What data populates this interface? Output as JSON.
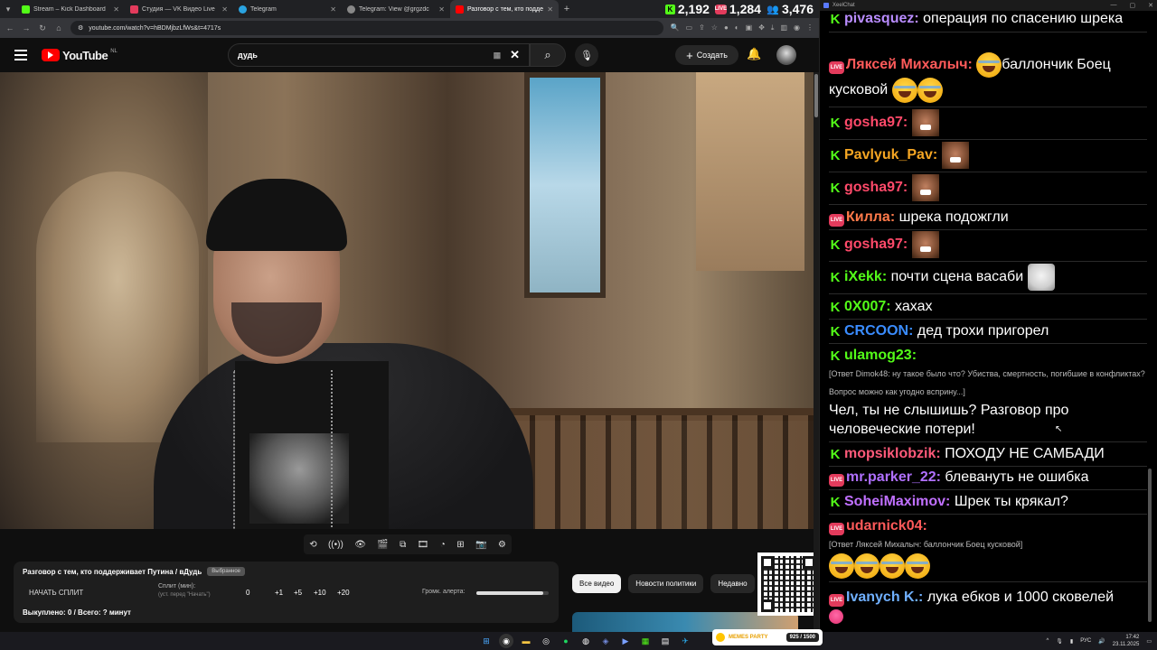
{
  "browser": {
    "tabs": [
      {
        "label": "Stream – Kick Dashboard",
        "color": "#53fc18"
      },
      {
        "label": "Студия — VK Видео Live",
        "color": "#e33b5c"
      },
      {
        "label": "Telegram",
        "color": "#2aa3e0"
      },
      {
        "label": "Telegram: View @grgzdc",
        "color": "#888888"
      },
      {
        "label": "Разговор с тем, кто поддерж...",
        "color": "#ff0000"
      }
    ],
    "url": "youtube.com/watch?v=hBDMjbzLfWs&t=4717s"
  },
  "stats": {
    "kick_viewers": "2,192",
    "vk_viewers": "1,284",
    "total_viewers": "3,476",
    "vk_badge": "LIVE",
    "kick_badge": "K"
  },
  "youtube": {
    "logo_text": "YouTube",
    "country": "NL",
    "search_value": "дудь",
    "create_label": "Создать",
    "chips": [
      "Все видео",
      "Новости политики",
      "Недавно"
    ]
  },
  "split_panel": {
    "title": "Разговор с тем, кто поддерживает Путина / вДудь",
    "tag": "Выбранное",
    "start_label": "НАЧАТЬ СПЛИТ",
    "min_label": "Сплит (мин):",
    "min_hint": "(уст. перед \"Начать\")",
    "values": [
      "0",
      "+1",
      "+5",
      "+10",
      "+20"
    ],
    "volume_label": "Громк. алерта:",
    "volume_level": 0.93,
    "footer": "Выкуплено: 0 / Всего: ? минут"
  },
  "chat": {
    "window_title": "XeelChat",
    "messages": [
      {
        "platform": "kick",
        "nick": "pivasquez:",
        "color": "#b98cff",
        "text": "операция по спасению шрека"
      },
      {
        "platform": "vk",
        "nick": "Ляксей Михалыч:",
        "color": "#ff5a5a",
        "text": "баллончик Боец кусковой"
      },
      {
        "platform": "kick",
        "nick": "gosha97:",
        "color": "#ff4a6a",
        "text": ""
      },
      {
        "platform": "kick",
        "nick": "Pavlyuk_Pav:",
        "color": "#f5a623",
        "text": ""
      },
      {
        "platform": "kick",
        "nick": "gosha97:",
        "color": "#ff4a6a",
        "text": ""
      },
      {
        "platform": "vk",
        "nick": "Килла:",
        "color": "#ff7a4a",
        "text": "шрека подожгли"
      },
      {
        "platform": "kick",
        "nick": "gosha97:",
        "color": "#ff4a6a",
        "text": ""
      },
      {
        "platform": "kick",
        "nick": "iXekk:",
        "color": "#53fc18",
        "text": "почти сцена васаби"
      },
      {
        "platform": "kick",
        "nick": "0X007:",
        "color": "#53fc18",
        "text": "хахах"
      },
      {
        "platform": "kick",
        "nick": "CRCOON:",
        "color": "#3a8cff",
        "text": "дед трохи пригорел"
      },
      {
        "platform": "kick",
        "nick": "ulamog23:",
        "color": "#53fc18",
        "reply": "[Ответ Dimok48: ну такое было что? Убиства, смертность, погибшие в конфликтах? Вопрос можно как угодно всприну...]",
        "text": "Чел, ты не слышишь? Разговор про человеческие потери!"
      },
      {
        "platform": "kick",
        "nick": "mopsiklobzik:",
        "color": "#ff5a7a",
        "text": "ПОХОДУ НЕ САМБАДИ"
      },
      {
        "platform": "vk",
        "nick": "mr.parker_22:",
        "color": "#b070ff",
        "text": "блевануть не ошибка"
      },
      {
        "platform": "kick",
        "nick": "SoheiMaximov:",
        "color": "#c070ff",
        "text": "Шрек ты крякал?"
      },
      {
        "platform": "vk",
        "nick": "udarnick04:",
        "color": "#ff5a5a",
        "reply": "[Ответ Ляксей Михалыч: баллончик Боец кусковой]",
        "text": ""
      },
      {
        "platform": "vk",
        "nick": "Ivanych K.:",
        "color": "#70b0ff",
        "text": "лука ебков и 1000 сковелей"
      }
    ]
  },
  "taskbar": {
    "memes_label": "MEMES PARTY",
    "memes_progress": "925 / 1500",
    "lang": "РУС",
    "time": "17:42",
    "date": "23.11.2025"
  }
}
